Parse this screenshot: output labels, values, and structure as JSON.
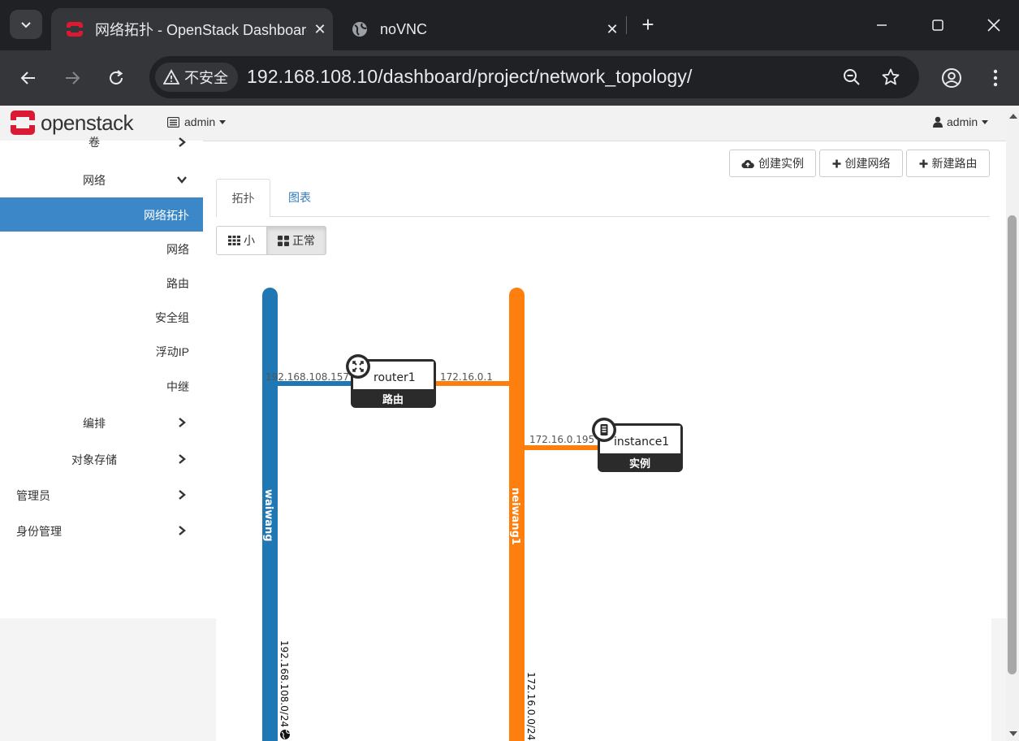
{
  "browser": {
    "tabs": [
      {
        "title": "网络拓扑 - OpenStack Dashboard",
        "active": true
      },
      {
        "title": "noVNC",
        "active": false
      }
    ],
    "security_label": "不安全",
    "url": "192.168.108.10/dashboard/project/network_topology/"
  },
  "header": {
    "logo_text": "openstack",
    "project": "admin",
    "user": "admin"
  },
  "sidebar": {
    "items": [
      {
        "label": "卷",
        "level": 1,
        "expanded": false
      },
      {
        "label": "网络",
        "level": 1,
        "expanded": true
      },
      {
        "label": "网络拓扑",
        "level": 2,
        "active": true
      },
      {
        "label": "网络",
        "level": 2
      },
      {
        "label": "路由",
        "level": 2
      },
      {
        "label": "安全组",
        "level": 2
      },
      {
        "label": "浮动IP",
        "level": 2
      },
      {
        "label": "中继",
        "level": 2
      },
      {
        "label": "编排",
        "level": 1,
        "expanded": false
      },
      {
        "label": "对象存储",
        "level": 1,
        "expanded": false
      },
      {
        "label": "管理员",
        "level": 0,
        "expanded": false
      },
      {
        "label": "身份管理",
        "level": 0,
        "expanded": false
      }
    ]
  },
  "actions": {
    "launch_instance": "创建实例",
    "create_network": "创建网络",
    "create_router": "新建路由"
  },
  "view_tabs": {
    "topology": "拓扑",
    "graph": "图表"
  },
  "size_toggle": {
    "small": "小",
    "normal": "正常"
  },
  "topology": {
    "networks": [
      {
        "name": "waiwang",
        "cidr": "192.168.108.0/24",
        "color": "#1f77b4",
        "external": true
      },
      {
        "name": "neiwang1",
        "cidr": "172.16.0.0/24",
        "color": "#ff7f0e",
        "external": false
      }
    ],
    "router": {
      "name": "router1",
      "type_label": "路由"
    },
    "instance": {
      "name": "instance1",
      "type_label": "实例"
    },
    "links": [
      {
        "ip": "192.168.108.157",
        "network": "waiwang",
        "device": "router1"
      },
      {
        "ip": "172.16.0.1",
        "network": "neiwang1",
        "device": "router1"
      },
      {
        "ip": "172.16.0.195",
        "network": "neiwang1",
        "device": "instance1"
      }
    ]
  },
  "colors": {
    "brand": "#da1a32",
    "active_nav": "#3b87c8",
    "link": "#337ab7",
    "network_external": "#1f77b4",
    "network_internal": "#ff7f0e",
    "device_dark": "#2b2b2b"
  }
}
